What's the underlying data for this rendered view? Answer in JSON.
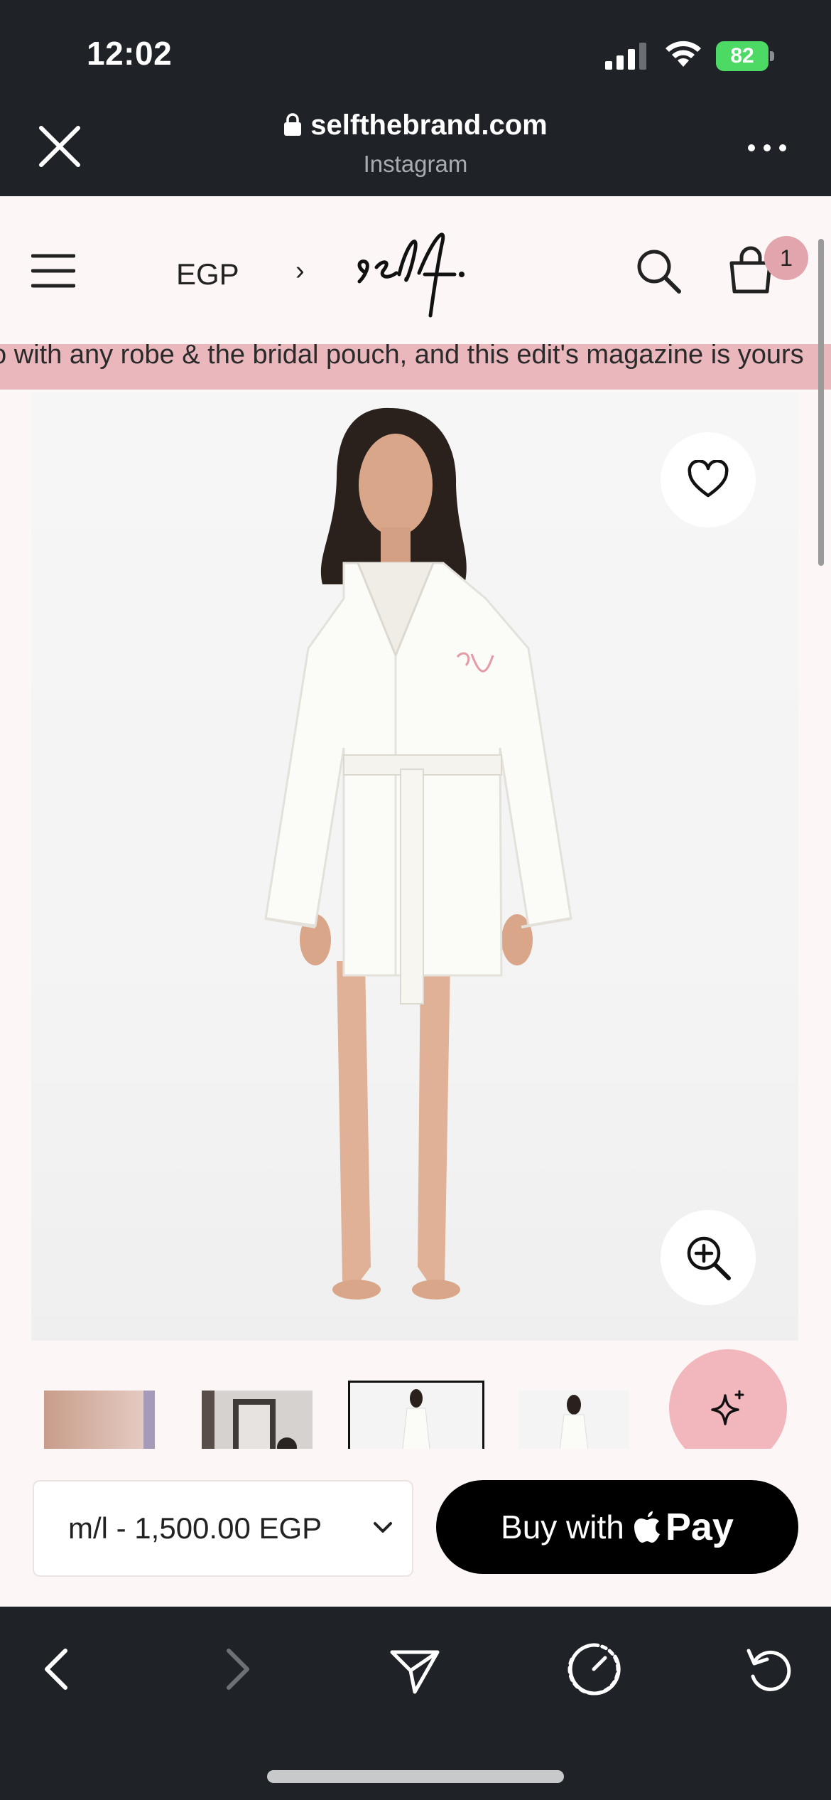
{
  "status_bar": {
    "time": "12:02",
    "battery": "82"
  },
  "browser": {
    "url": "selfthebrand.com",
    "source": "Instagram"
  },
  "site": {
    "currency": "EGP",
    "cart_count": "1",
    "marquee": "o with any robe & the bridal pouch, and this edit's magazine is yours"
  },
  "product": {
    "variant": "m/l - 1,500.00 EGP",
    "buy_label": "Buy with",
    "buy_brand": "Pay"
  },
  "colors": {
    "accent_pink": "#eab7bd",
    "badge_pink": "#e2a5ad",
    "chrome_dark": "#1f2226"
  }
}
